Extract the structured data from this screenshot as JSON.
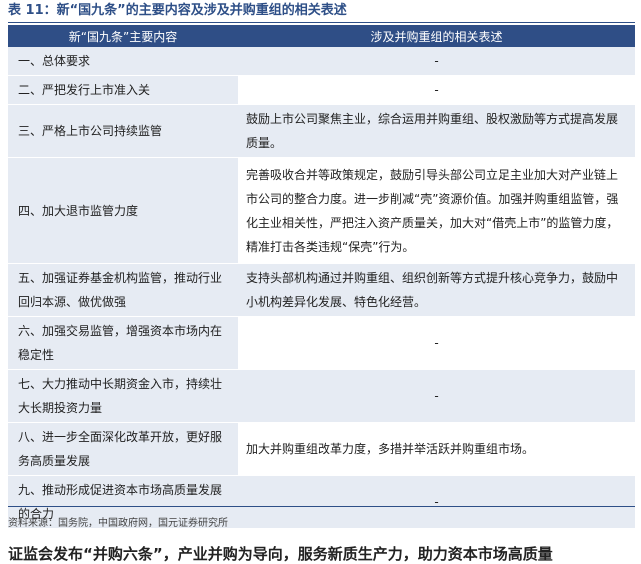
{
  "table_title": "表 11：新“国九条”的主要内容及涉及并购重组的相关表述",
  "headers": [
    "新“国九条”主要内容",
    "涉及并购重组的相关表述"
  ],
  "rows": [
    {
      "left": "一、总体要求",
      "right": "-"
    },
    {
      "left": "二、严把发行上市准入关",
      "right": "-"
    },
    {
      "left": "三、严格上市公司持续监管",
      "right": "鼓励上市公司聚焦主业，综合运用并购重组、股权激励等方式提高发展质量。"
    },
    {
      "left": "四、加大退市监管力度",
      "right": "完善吸收合并等政策规定，鼓励引导头部公司立足主业加大对产业链上市公司的整合力度。进一步削减“壳”资源价值。加强并购重组监管，强化主业相关性，严把注入资产质量关，加大对“借壳上市”的监管力度，精准打击各类违规“保壳”行为。"
    },
    {
      "left": "五、加强证券基金机构监管，推动行业回归本源、做优做强",
      "right": "支持头部机构通过并购重组、组织创新等方式提升核心竞争力，鼓励中小机构差异化发展、特色化经营。"
    },
    {
      "left": "六、加强交易监管，增强资本市场内在稳定性",
      "right": "-"
    },
    {
      "left": "七、大力推动中长期资金入市，持续壮大长期投资力量",
      "right": "-"
    },
    {
      "left": "八、进一步全面深化改革开放，更好服务高质量发展",
      "right": "加大并购重组改革力度，多措并举活跃并购重组市场。"
    },
    {
      "left": "九、推动形成促进资本市场高质量发展的合力",
      "right": "-"
    }
  ],
  "source": "资料来源：国务院，中国政府网，国元证券研究所",
  "next_heading": "证监会发布“并购六条”，产业并购为导向，服务新质生产力，助力资本市场高质量"
}
